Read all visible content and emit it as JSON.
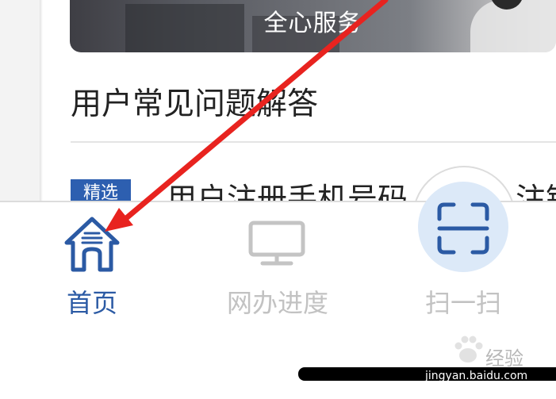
{
  "banner": {
    "text": "全心服务"
  },
  "faq": {
    "title": "用户常见问题解答",
    "featured": {
      "badge": "精选",
      "title_start": "用户注册手机号码",
      "title_end": "注销"
    }
  },
  "tabbar": {
    "items": [
      {
        "label": "首页",
        "icon": "home-icon",
        "active": true
      },
      {
        "label": "网办进度",
        "icon": "monitor-icon",
        "active": false
      },
      {
        "label": "扫一扫",
        "icon": "scan-icon",
        "active": false
      }
    ],
    "active_color": "#2b5aa4",
    "inactive_color": "#c2c2c2"
  },
  "annotation": {
    "color": "#e8231f",
    "type": "arrow"
  },
  "watermark": {
    "text": "经验",
    "url": "jingyan.baidu.com"
  }
}
